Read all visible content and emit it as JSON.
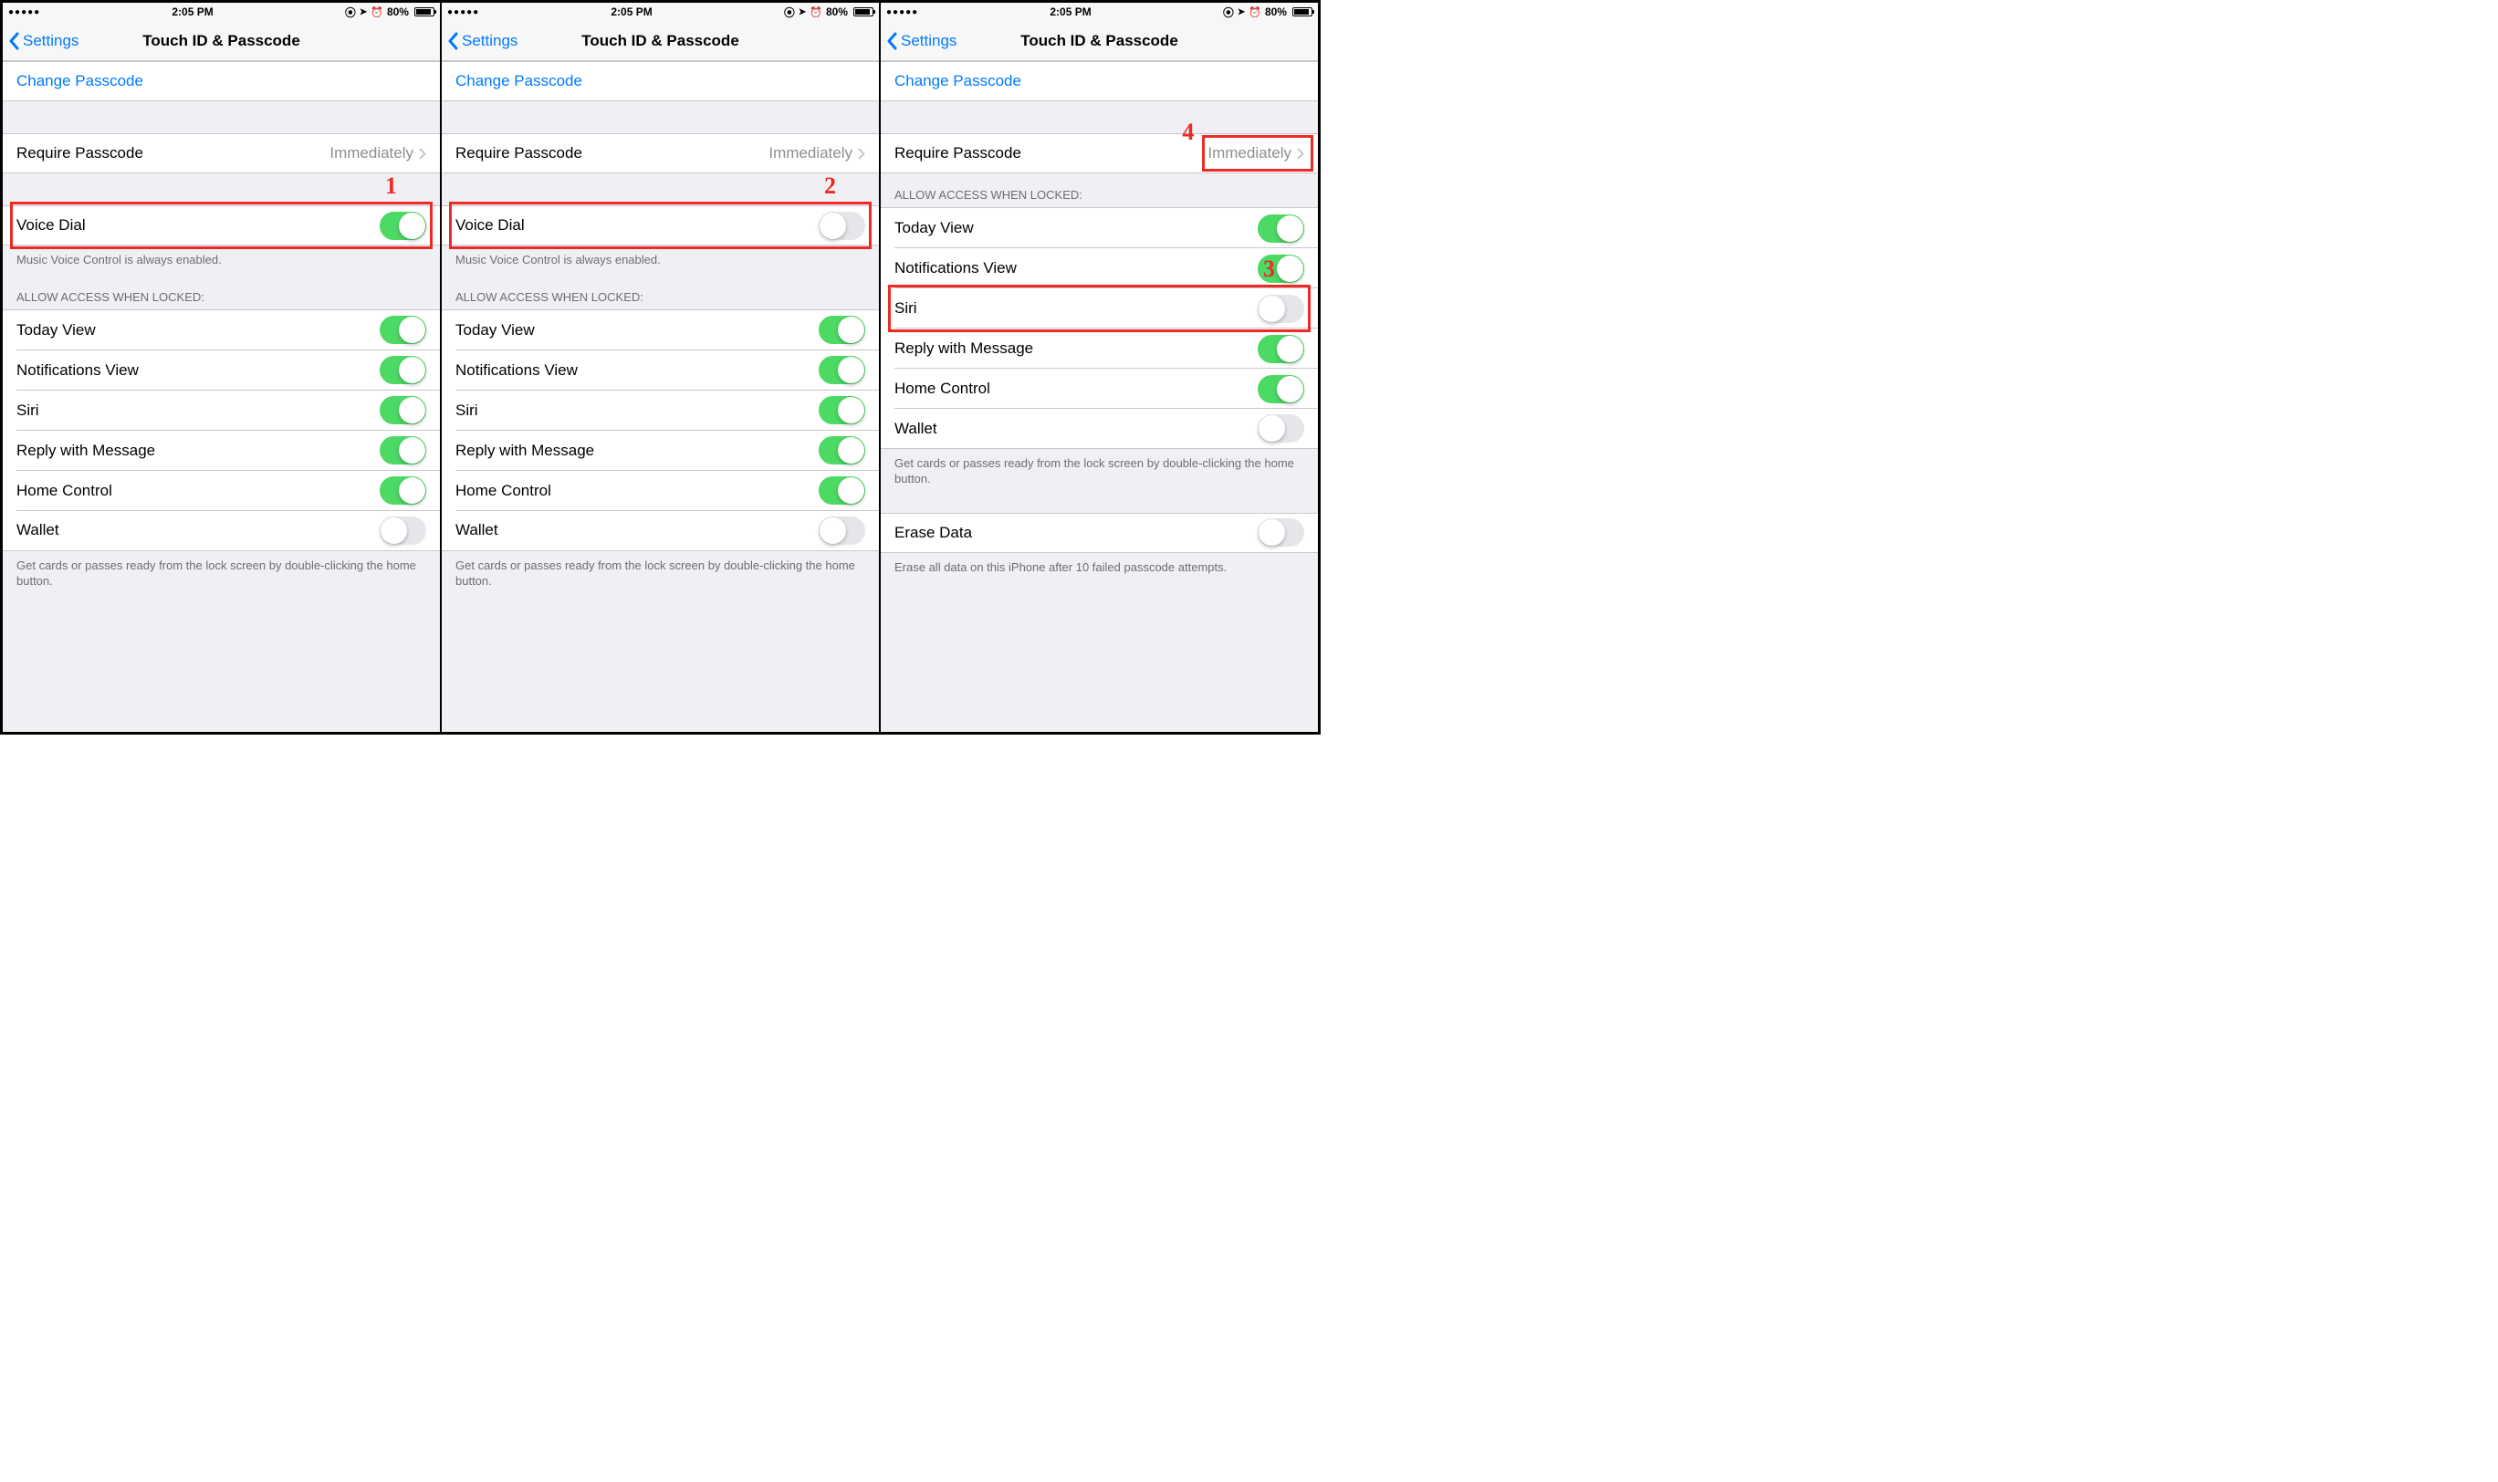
{
  "status": {
    "signal_dots": "●●●●●",
    "time": "2:05 PM",
    "lock_glyph": "⦿",
    "location_glyph": "➤",
    "alarm_glyph": "⏰",
    "battery_pct": "80%"
  },
  "nav": {
    "back_label": "Settings",
    "title": "Touch ID & Passcode"
  },
  "cells": {
    "change_passcode": "Change Passcode",
    "require_passcode": "Require Passcode",
    "require_passcode_value": "Immediately",
    "voice_dial": "Voice Dial",
    "voice_dial_footer": "Music Voice Control is always enabled.",
    "allow_access_header": "ALLOW ACCESS WHEN LOCKED:",
    "today_view": "Today View",
    "notifications_view": "Notifications View",
    "siri": "Siri",
    "reply_with_message": "Reply with Message",
    "home_control": "Home Control",
    "wallet": "Wallet",
    "wallet_footer": "Get cards or passes ready from the lock screen by double-clicking the home button.",
    "erase_data": "Erase Data",
    "erase_data_footer": "Erase all data on this iPhone after 10 failed passcode attempts."
  },
  "annotations": {
    "a1": "1",
    "a2": "2",
    "a3": "3",
    "a4": "4"
  },
  "screens": [
    {
      "voice_dial_on": true,
      "show_voice_dial": true,
      "access": {
        "today": true,
        "notifications": true,
        "siri": true,
        "reply": true,
        "home": true,
        "wallet": false
      },
      "show_erase": false,
      "annotation": {
        "num_key": "a1",
        "target": "voice_dial_row",
        "label_pos": "right-above",
        "highlight": null
      }
    },
    {
      "voice_dial_on": false,
      "show_voice_dial": true,
      "access": {
        "today": true,
        "notifications": true,
        "siri": true,
        "reply": true,
        "home": true,
        "wallet": false
      },
      "show_erase": false,
      "annotation": {
        "num_key": "a2",
        "target": "voice_dial_row",
        "label_pos": "right-above",
        "highlight": null
      }
    },
    {
      "voice_dial_on": false,
      "show_voice_dial": false,
      "access": {
        "today": true,
        "notifications": true,
        "siri": false,
        "reply": true,
        "home": true,
        "wallet": false
      },
      "show_erase": true,
      "annotation": {
        "num_key": "a3",
        "target": "siri_row",
        "label_pos": "right-above",
        "highlight": {
          "num_key": "a4",
          "target": "require_value"
        }
      }
    }
  ]
}
